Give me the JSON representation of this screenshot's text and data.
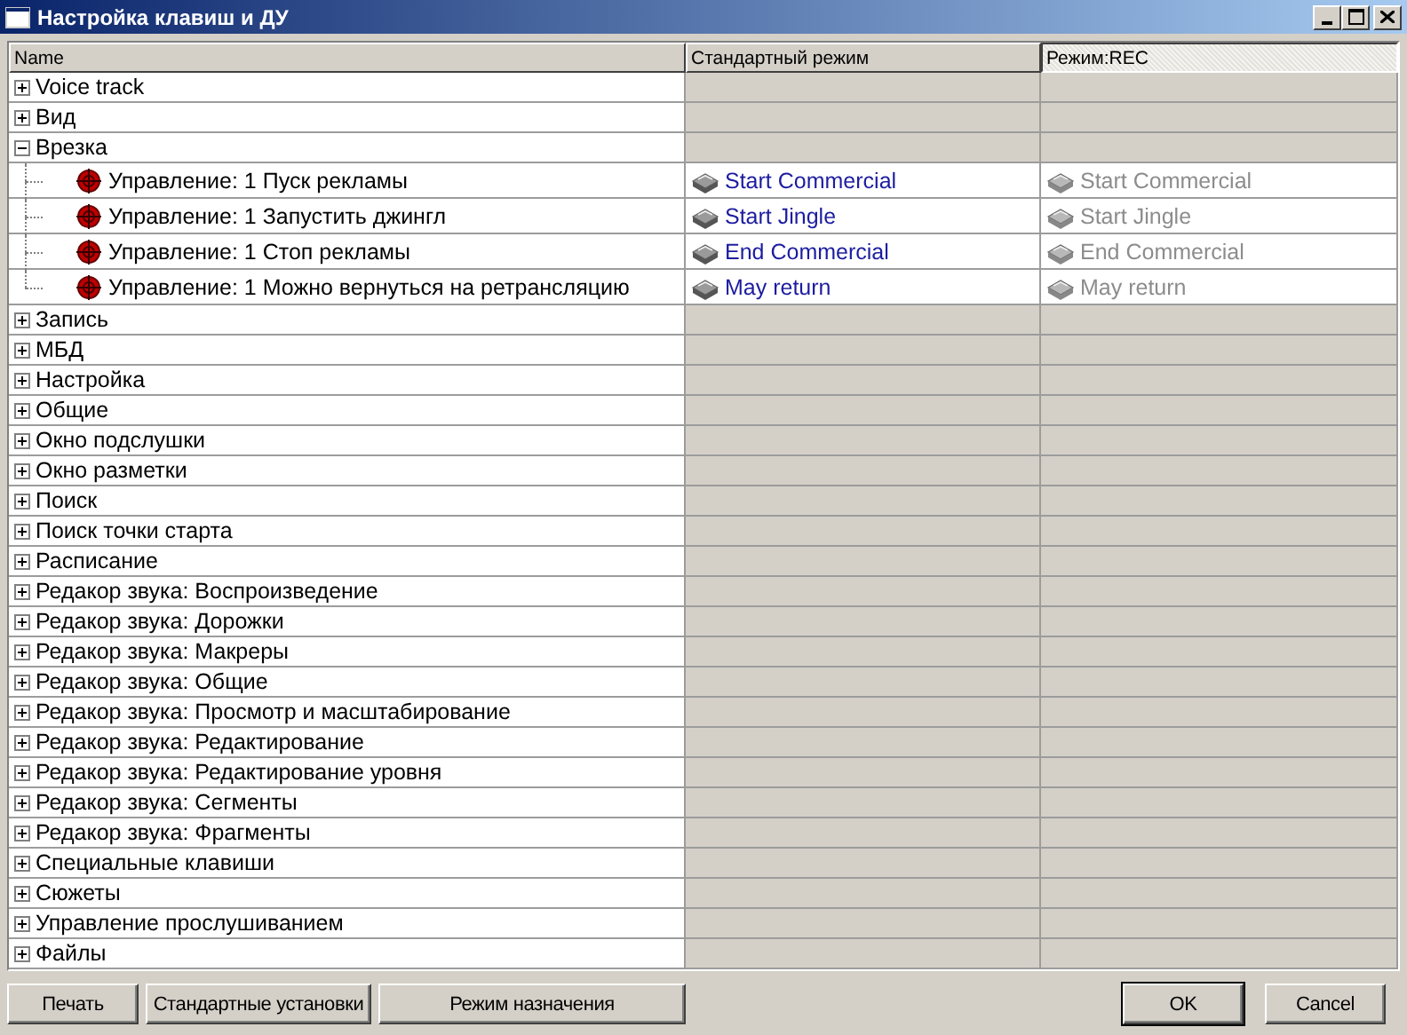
{
  "window": {
    "title": "Настройка клавиш и ДУ"
  },
  "columns": [
    {
      "label": "Name",
      "selected": false
    },
    {
      "label": "Стандартный режим",
      "selected": false
    },
    {
      "label": "Режим:REC",
      "selected": true
    }
  ],
  "tree": [
    {
      "label": "Voice track",
      "expanded": false
    },
    {
      "label": "Вид",
      "expanded": false
    },
    {
      "label": "Врезка",
      "expanded": true,
      "children": [
        {
          "label": "Управление: 1 Пуск рекламы",
          "standard": {
            "text": "Start Commercial",
            "disabled": false
          },
          "rec": {
            "text": "Start Commercial",
            "disabled": true
          }
        },
        {
          "label": "Управление: 1 Запустить джингл",
          "standard": {
            "text": "Start Jingle",
            "disabled": false
          },
          "rec": {
            "text": "Start Jingle",
            "disabled": true
          }
        },
        {
          "label": "Управление: 1 Стоп рекламы",
          "standard": {
            "text": "End Commercial",
            "disabled": false
          },
          "rec": {
            "text": "End Commercial",
            "disabled": true
          }
        },
        {
          "label": "Управление: 1 Можно вернуться на ретрансляцию",
          "standard": {
            "text": "May return",
            "disabled": false
          },
          "rec": {
            "text": "May return",
            "disabled": true
          }
        }
      ]
    },
    {
      "label": "Запись",
      "expanded": false
    },
    {
      "label": "МБД",
      "expanded": false
    },
    {
      "label": "Настройка",
      "expanded": false
    },
    {
      "label": "Общие",
      "expanded": false
    },
    {
      "label": "Окно подслушки",
      "expanded": false
    },
    {
      "label": "Окно разметки",
      "expanded": false
    },
    {
      "label": "Поиск",
      "expanded": false
    },
    {
      "label": "Поиск точки старта",
      "expanded": false
    },
    {
      "label": "Расписание",
      "expanded": false
    },
    {
      "label": "Редакор звука: Воспроизведение",
      "expanded": false
    },
    {
      "label": "Редакор звука: Дорожки",
      "expanded": false
    },
    {
      "label": "Редакор звука: Макреры",
      "expanded": false
    },
    {
      "label": "Редакор звука: Общие",
      "expanded": false
    },
    {
      "label": "Редакор звука: Просмотр и масштабирование",
      "expanded": false
    },
    {
      "label": "Редакор звука: Редактирование",
      "expanded": false
    },
    {
      "label": "Редакор звука: Редактирование уровня",
      "expanded": false
    },
    {
      "label": "Редакор звука: Сегменты",
      "expanded": false
    },
    {
      "label": "Редакор звука: Фрагменты",
      "expanded": false
    },
    {
      "label": "Специальные клавиши",
      "expanded": false
    },
    {
      "label": "Сюжеты",
      "expanded": false
    },
    {
      "label": "Управление прослушиванием",
      "expanded": false
    },
    {
      "label": "Файлы",
      "expanded": false
    }
  ],
  "footer": {
    "left_buttons": [
      {
        "label": "Печать"
      },
      {
        "label": "Стандартные установки"
      },
      {
        "label": "Режим назначения"
      }
    ],
    "right_buttons": [
      {
        "label": "OK",
        "default": true
      },
      {
        "label": "Cancel",
        "default": false
      }
    ]
  }
}
